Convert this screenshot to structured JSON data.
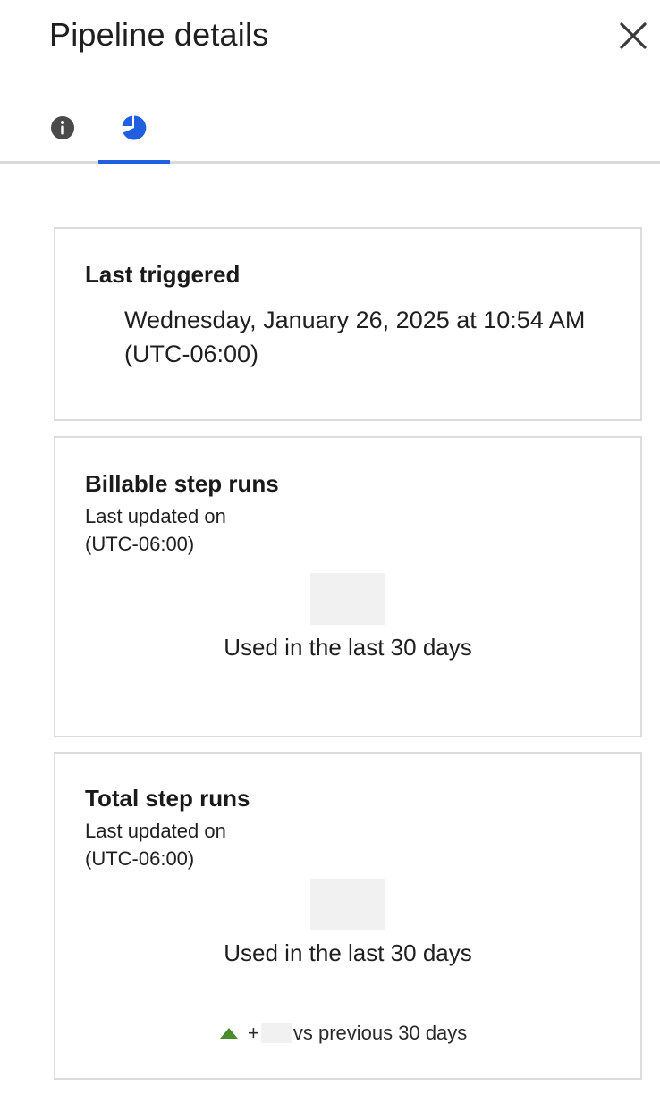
{
  "header": {
    "title": "Pipeline details",
    "close_icon": "close-icon"
  },
  "tabs": [
    {
      "name": "info",
      "icon": "info-icon",
      "active": false
    },
    {
      "name": "statistics",
      "icon": "pie-chart-icon",
      "active": true
    }
  ],
  "colors": {
    "accent": "#1f5fe0",
    "info_icon": "#4a4a4a",
    "trend_up": "#4b8b2b",
    "border": "#dcdcdc",
    "placeholder": "#f1f1f1"
  },
  "last_triggered": {
    "title": "Last triggered",
    "value": "Wednesday, January 26, 2025 at 10:54 AM (UTC-06:00)"
  },
  "billable": {
    "title": "Billable step runs",
    "updated_label": "Last updated on",
    "timezone": "(UTC-06:00)",
    "used_label": "Used in the last 30 days"
  },
  "total": {
    "title": "Total step runs",
    "updated_label": "Last updated on",
    "timezone": "(UTC-06:00)",
    "used_label": "Used in the last 30 days",
    "trend_prefix": "+",
    "trend_suffix": "vs previous 30 days",
    "trend_icon": "triangle-up-icon"
  }
}
